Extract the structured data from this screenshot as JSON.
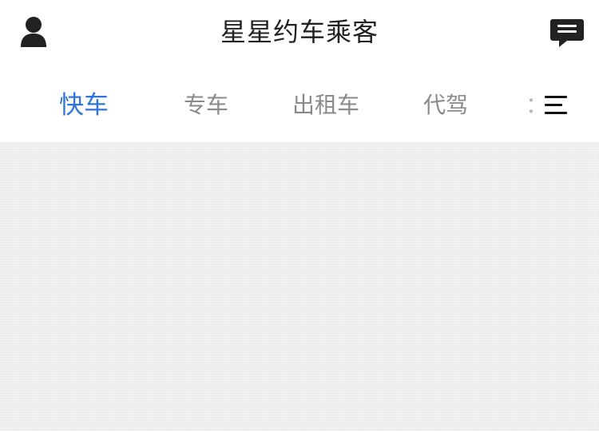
{
  "header": {
    "title": "星星约车乘客",
    "left_icon": "profile-icon",
    "right_icon": "message-icon"
  },
  "tabs": [
    {
      "label": "快车",
      "active": true
    },
    {
      "label": "专车",
      "active": false
    },
    {
      "label": "出租车",
      "active": false
    },
    {
      "label": "代驾",
      "active": false
    },
    {
      "label": "：",
      "active": false,
      "partially_visible": true
    }
  ],
  "tab_menu": {
    "icon": "menu-icon"
  },
  "colors": {
    "active_tab": "#2f74d8",
    "inactive_tab": "#8a8a8a",
    "title_text": "#222222",
    "content_background": "#f1f1f1"
  }
}
